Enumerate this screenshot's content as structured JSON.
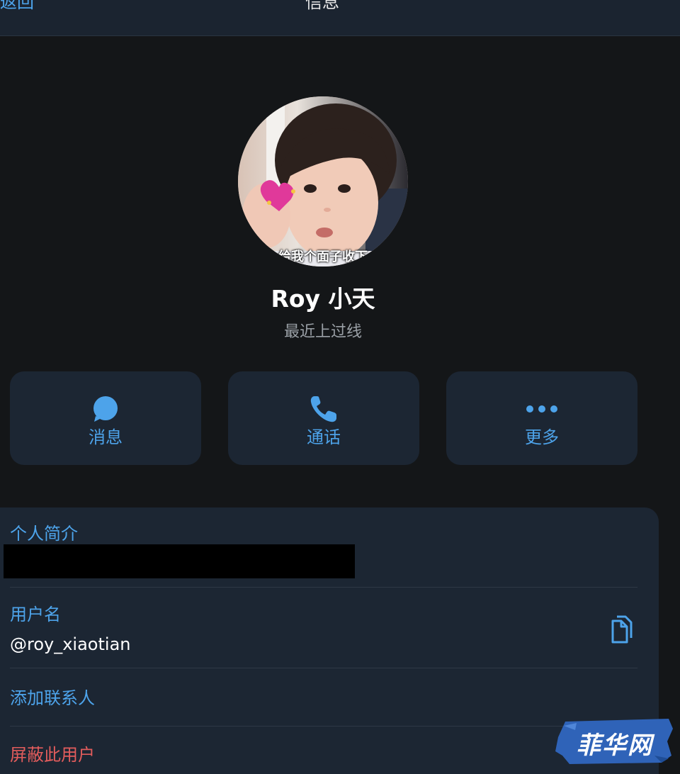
{
  "header": {
    "back_label": "返回",
    "title": "信息"
  },
  "profile": {
    "avatar_caption": "给我个面子收下",
    "name": "Roy 小天",
    "status": "最近上过线"
  },
  "actions": [
    {
      "label": "消息",
      "icon": "chat-bubble-icon"
    },
    {
      "label": "通话",
      "icon": "phone-icon"
    },
    {
      "label": "更多",
      "icon": "more-dots-icon"
    }
  ],
  "info": {
    "bio_label": "个人简介",
    "username_label": "用户名",
    "username_value": "@roy_xiaotian",
    "add_contact": "添加联系人",
    "block_user": "屏蔽此用户"
  },
  "watermark": {
    "text": "菲华网"
  },
  "colors": {
    "accent": "#4da3ea",
    "danger": "#e25c5c",
    "card": "#1c2633",
    "background": "#141618"
  }
}
